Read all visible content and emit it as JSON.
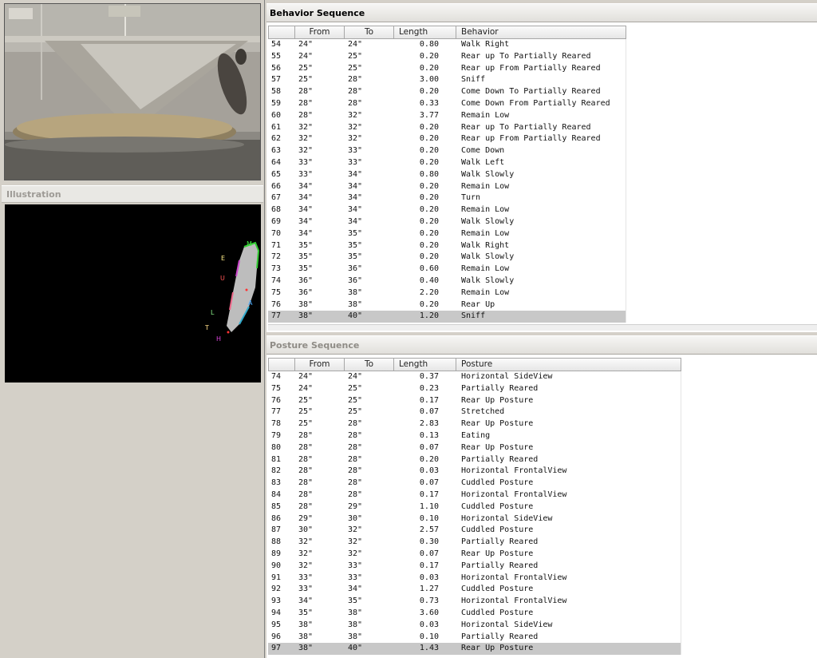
{
  "illustration": {
    "title": "Illustration",
    "point_labels": [
      "M",
      "E",
      "U",
      "L",
      "A",
      "T",
      "H"
    ]
  },
  "behavior": {
    "title": "Behavior Sequence",
    "columns": [
      "",
      "From",
      "To",
      "Length",
      "Behavior"
    ],
    "rows": [
      [
        "54",
        "24\"",
        "24\"",
        "0.80",
        "Walk Right"
      ],
      [
        "55",
        "24\"",
        "25\"",
        "0.20",
        "Rear up To Partially Reared"
      ],
      [
        "56",
        "25\"",
        "25\"",
        "0.20",
        "Rear up From Partially Reared"
      ],
      [
        "57",
        "25\"",
        "28\"",
        "3.00",
        "Sniff"
      ],
      [
        "58",
        "28\"",
        "28\"",
        "0.20",
        "Come Down To Partially Reared"
      ],
      [
        "59",
        "28\"",
        "28\"",
        "0.33",
        "Come Down From Partially Reared"
      ],
      [
        "60",
        "28\"",
        "32\"",
        "3.77",
        "Remain Low"
      ],
      [
        "61",
        "32\"",
        "32\"",
        "0.20",
        "Rear up To Partially Reared"
      ],
      [
        "62",
        "32\"",
        "32\"",
        "0.20",
        "Rear up From Partially Reared"
      ],
      [
        "63",
        "32\"",
        "33\"",
        "0.20",
        "Come Down"
      ],
      [
        "64",
        "33\"",
        "33\"",
        "0.20",
        "Walk Left"
      ],
      [
        "65",
        "33\"",
        "34\"",
        "0.80",
        "Walk Slowly"
      ],
      [
        "66",
        "34\"",
        "34\"",
        "0.20",
        "Remain Low"
      ],
      [
        "67",
        "34\"",
        "34\"",
        "0.20",
        "Turn"
      ],
      [
        "68",
        "34\"",
        "34\"",
        "0.20",
        "Remain Low"
      ],
      [
        "69",
        "34\"",
        "34\"",
        "0.20",
        "Walk Slowly"
      ],
      [
        "70",
        "34\"",
        "35\"",
        "0.20",
        "Remain Low"
      ],
      [
        "71",
        "35\"",
        "35\"",
        "0.20",
        "Walk Right"
      ],
      [
        "72",
        "35\"",
        "35\"",
        "0.20",
        "Walk Slowly"
      ],
      [
        "73",
        "35\"",
        "36\"",
        "0.60",
        "Remain Low"
      ],
      [
        "74",
        "36\"",
        "36\"",
        "0.40",
        "Walk Slowly"
      ],
      [
        "75",
        "36\"",
        "38\"",
        "2.20",
        "Remain Low"
      ],
      [
        "76",
        "38\"",
        "38\"",
        "0.20",
        "Rear Up"
      ],
      [
        "77",
        "38\"",
        "40\"",
        "1.20",
        "Sniff"
      ]
    ],
    "selected_row": 23
  },
  "posture": {
    "title": "Posture Sequence",
    "columns": [
      "",
      "From",
      "To",
      "Length",
      "Posture"
    ],
    "rows": [
      [
        "74",
        "24\"",
        "24\"",
        "0.37",
        "Horizontal SideView"
      ],
      [
        "75",
        "24\"",
        "25\"",
        "0.23",
        "Partially Reared"
      ],
      [
        "76",
        "25\"",
        "25\"",
        "0.17",
        "Rear Up Posture"
      ],
      [
        "77",
        "25\"",
        "25\"",
        "0.07",
        "Stretched"
      ],
      [
        "78",
        "25\"",
        "28\"",
        "2.83",
        "Rear Up Posture"
      ],
      [
        "79",
        "28\"",
        "28\"",
        "0.13",
        "Eating"
      ],
      [
        "80",
        "28\"",
        "28\"",
        "0.07",
        "Rear Up Posture"
      ],
      [
        "81",
        "28\"",
        "28\"",
        "0.20",
        "Partially Reared"
      ],
      [
        "82",
        "28\"",
        "28\"",
        "0.03",
        "Horizontal FrontalView"
      ],
      [
        "83",
        "28\"",
        "28\"",
        "0.07",
        "Cuddled Posture"
      ],
      [
        "84",
        "28\"",
        "28\"",
        "0.17",
        "Horizontal FrontalView"
      ],
      [
        "85",
        "28\"",
        "29\"",
        "1.10",
        "Cuddled Posture"
      ],
      [
        "86",
        "29\"",
        "30\"",
        "0.10",
        "Horizontal SideView"
      ],
      [
        "87",
        "30\"",
        "32\"",
        "2.57",
        "Cuddled Posture"
      ],
      [
        "88",
        "32\"",
        "32\"",
        "0.30",
        "Partially Reared"
      ],
      [
        "89",
        "32\"",
        "32\"",
        "0.07",
        "Rear Up Posture"
      ],
      [
        "90",
        "32\"",
        "33\"",
        "0.17",
        "Partially Reared"
      ],
      [
        "91",
        "33\"",
        "33\"",
        "0.03",
        "Horizontal FrontalView"
      ],
      [
        "92",
        "33\"",
        "34\"",
        "1.27",
        "Cuddled Posture"
      ],
      [
        "93",
        "34\"",
        "35\"",
        "0.73",
        "Horizontal FrontalView"
      ],
      [
        "94",
        "35\"",
        "38\"",
        "3.60",
        "Cuddled Posture"
      ],
      [
        "95",
        "38\"",
        "38\"",
        "0.03",
        "Horizontal SideView"
      ],
      [
        "96",
        "38\"",
        "38\"",
        "0.10",
        "Partially Reared"
      ],
      [
        "97",
        "38\"",
        "40\"",
        "1.43",
        "Rear Up Posture"
      ]
    ],
    "selected_row": 23
  }
}
